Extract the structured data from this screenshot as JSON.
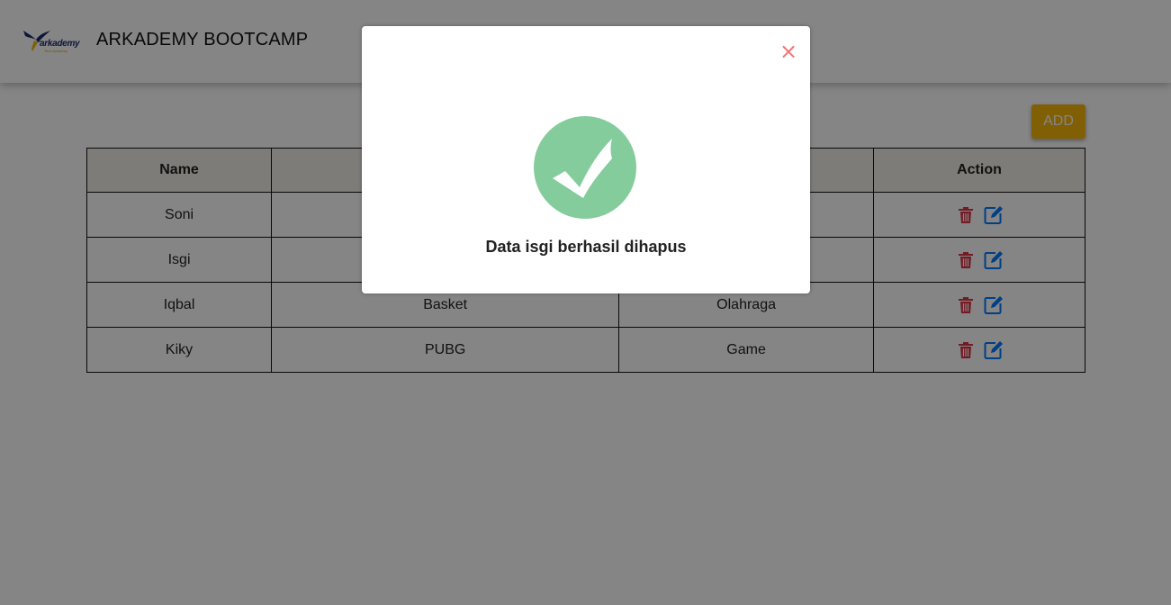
{
  "header": {
    "logo_text": "arkademy",
    "logo_sub": "Tech Academy",
    "title": "ARKADEMY BOOTCAMP"
  },
  "toolbar": {
    "add_label": "ADD"
  },
  "table": {
    "headers": [
      "Name",
      "",
      "",
      "Action"
    ],
    "rows": [
      {
        "name": "Soni",
        "hobby": "",
        "category": ""
      },
      {
        "name": "Isgi",
        "hobby": "",
        "category": ""
      },
      {
        "name": "Iqbal",
        "hobby": "Basket",
        "category": "Olahraga"
      },
      {
        "name": "Kiky",
        "hobby": "PUBG",
        "category": "Game"
      }
    ],
    "row_icons": [
      "trash-icon",
      "edit-icon"
    ]
  },
  "modal": {
    "close_symbol": "×",
    "icon": "success-check-icon",
    "message": "Data isgi berhasil dihapus"
  },
  "colors": {
    "add_button": "#f5b70b",
    "delete_icon": "#dc3545",
    "edit_icon": "#007bff",
    "success_circle": "#a5dc86",
    "close_icon": "#f27474",
    "overlay": "rgba(0,0,0,0.48)"
  }
}
